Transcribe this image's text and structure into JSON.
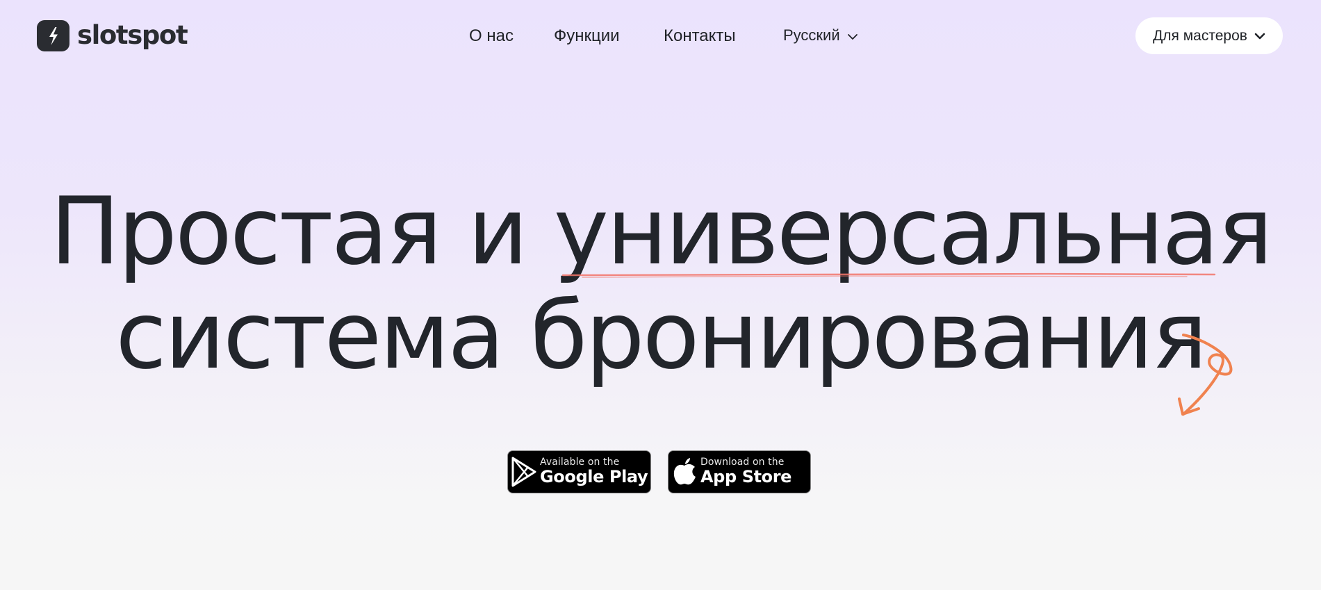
{
  "brand": {
    "name": "slotspot"
  },
  "nav": {
    "items": [
      {
        "label": "О нас"
      },
      {
        "label": "Функции"
      },
      {
        "label": "Контакты"
      }
    ],
    "language": "Русский",
    "cta_label": "Для мастеров"
  },
  "hero": {
    "line1_plain": "Простая и",
    "line1_highlight": "универсальная",
    "line2": "система бронирования"
  },
  "stores": {
    "google": {
      "small": "Available on the",
      "big": "Google Play",
      "icon": "google-play-icon"
    },
    "apple": {
      "small": "Download on the",
      "big": "App Store",
      "icon": "apple-icon"
    }
  },
  "colors": {
    "accent_underline": "#f2766a",
    "accent_arrow": "#f0824f",
    "text": "#22252b",
    "bg_top": "#ebe3fd",
    "bg_bottom": "#f6f6f6"
  }
}
